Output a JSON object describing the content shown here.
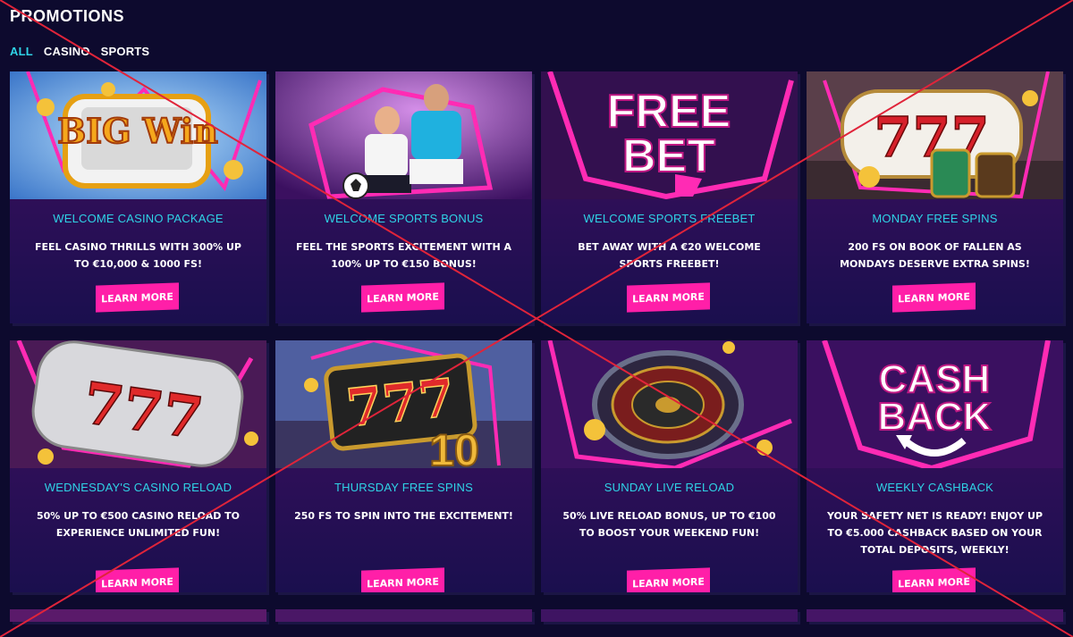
{
  "page": {
    "title": "PROMOTIONS"
  },
  "filters": [
    {
      "label": "ALL",
      "active": true
    },
    {
      "label": "CASINO",
      "active": false
    },
    {
      "label": "SPORTS",
      "active": false
    }
  ],
  "promotions": [
    {
      "title": "WELCOME CASINO PACKAGE",
      "desc": "FEEL CASINO THRILLS WITH 300% UP TO €10,000 & 1000 FS!",
      "button": "LEARN MORE",
      "image": "big-win-slot-image",
      "image_text": "BIG Win"
    },
    {
      "title": "WELCOME SPORTS BONUS",
      "desc": "FEEL THE SPORTS EXCITEMENT WITH A 100% UP TO €150 BONUS!",
      "button": "LEARN MORE",
      "image": "football-players-image"
    },
    {
      "title": "WELCOME SPORTS FREEBET",
      "desc": "BET AWAY WITH A €20 WELCOME SPORTS FREEBET!",
      "button": "LEARN MORE",
      "image": "free-bet-image",
      "image_text": "FREE BET"
    },
    {
      "title": "MONDAY FREE SPINS",
      "desc": "200 FS ON BOOK OF FALLEN AS MONDAYS DESERVE EXTRA SPINS!",
      "button": "LEARN MORE",
      "image": "777-pharaoh-slot-image",
      "image_text": "777"
    },
    {
      "title": "WEDNESDAY'S CASINO RELOAD",
      "desc": "50% UP TO €500 CASINO RELOAD TO EXPERIENCE UNLIMITED FUN!",
      "button": "LEARN MORE",
      "image": "777-silver-slot-image",
      "image_text": "777"
    },
    {
      "title": "THURSDAY FREE SPINS",
      "desc": "250 FS TO SPIN INTO THE EXCITEMENT!",
      "button": "LEARN MORE",
      "image": "777-coins-slot-image",
      "image_text": "777"
    },
    {
      "title": "SUNDAY LIVE RELOAD",
      "desc": "50% LIVE RELOAD BONUS, UP TO €100 TO BOOST YOUR WEEKEND FUN!",
      "button": "LEARN MORE",
      "image": "roulette-wheel-image"
    },
    {
      "title": "WEEKLY CASHBACK",
      "desc": "YOUR SAFETY NET IS READY! ENJOY UP TO €5.000 CASHBACK BASED ON YOUR TOTAL DEPOSITS, WEEKLY!",
      "button": "LEARN MORE",
      "image": "cash-back-image",
      "image_text": "CASH BACK"
    }
  ],
  "colors": {
    "background": "#0d0a2e",
    "accent_cyan": "#2fd3e6",
    "button_pink": "#ff1fa8",
    "cross_red": "#e0243a"
  }
}
